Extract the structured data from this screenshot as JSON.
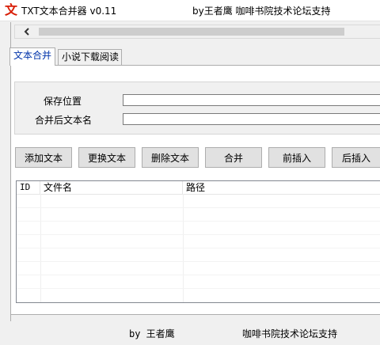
{
  "window": {
    "title": "TXT文本合并器 v0.11",
    "title_credit": "by王者鹰 咖啡书院技术论坛支持",
    "icon": "文",
    "icon_color": "#d81e06"
  },
  "tabs": [
    {
      "label": "文本合并",
      "active": true
    },
    {
      "label": "小说下载阅读",
      "active": false
    }
  ],
  "form": {
    "save_location_label": "保存位置",
    "save_location_value": "",
    "merged_name_label": "合并后文本名",
    "merged_name_value": ""
  },
  "buttons": {
    "add": "添加文本",
    "replace": "更换文本",
    "delete": "删除文本",
    "merge": "合并",
    "insert_before": "前插入",
    "insert_after": "后插入"
  },
  "file_list": {
    "columns": [
      "ID",
      "文件名",
      "路径"
    ],
    "rows": []
  },
  "status": {
    "author": "by 王者鹰",
    "support": "咖啡书院技术论坛支持"
  },
  "colors": {
    "accent_tab_text": "#0033aa",
    "window_bg": "#f0f0f0"
  }
}
